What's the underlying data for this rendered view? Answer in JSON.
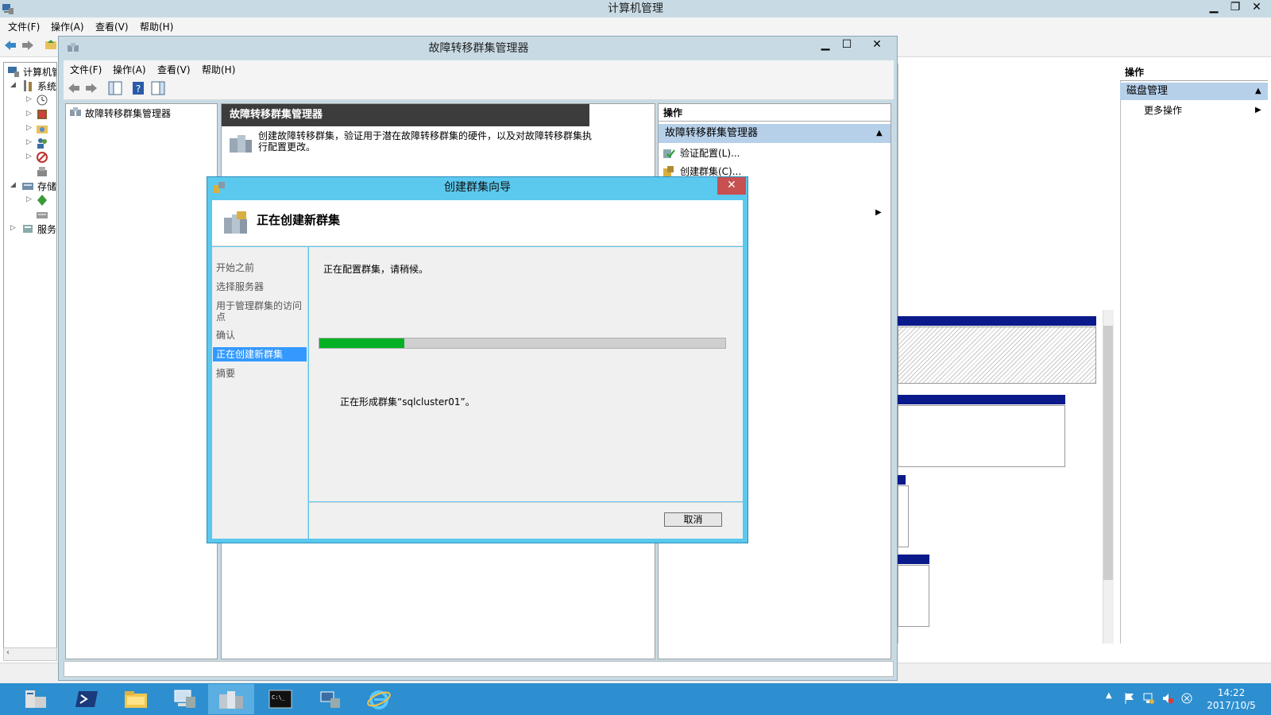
{
  "computer_management": {
    "title": "计算机管理",
    "menu": [
      "文件(F)",
      "操作(A)",
      "查看(V)",
      "帮助(H)"
    ],
    "tree": {
      "root": "计算机管",
      "system": "系统",
      "storage": "存储",
      "services": "服务"
    },
    "actions": {
      "header": "操作",
      "section": "磁盘管理",
      "more": "更多操作"
    }
  },
  "failover_cluster_manager": {
    "title": "故障转移群集管理器",
    "menu": [
      "文件(F)",
      "操作(A)",
      "查看(V)",
      "帮助(H)"
    ],
    "tree_root": "故障转移群集管理器",
    "center": {
      "heading": "故障转移群集管理器",
      "description": "创建故障转移群集，验证用于潜在故障转移群集的硬件，以及对故障转移群集执行配置更改。"
    },
    "actions": {
      "header": "操作",
      "section": "故障转移群集管理器",
      "items": [
        "验证配置(L)...",
        "创建群集(C)..."
      ]
    }
  },
  "wizard": {
    "title": "创建群集向导",
    "header": "正在创建新群集",
    "steps": [
      "开始之前",
      "选择服务器",
      "用于管理群集的访问点",
      "确认",
      "正在创建新群集",
      "摘要"
    ],
    "active_step": 4,
    "status": "正在配置群集，请稍候。",
    "progress": 0.21,
    "message": "正在形成群集“sqlcluster01”。",
    "cancel_label": "取消"
  },
  "taskbar": {
    "time": "14:22",
    "date": "2017/10/5"
  },
  "colors": {
    "taskbar": "#2d8fd0",
    "wizard_frame": "#5bc8ee",
    "progress": "#06b025",
    "active_step": "#3399ff"
  }
}
